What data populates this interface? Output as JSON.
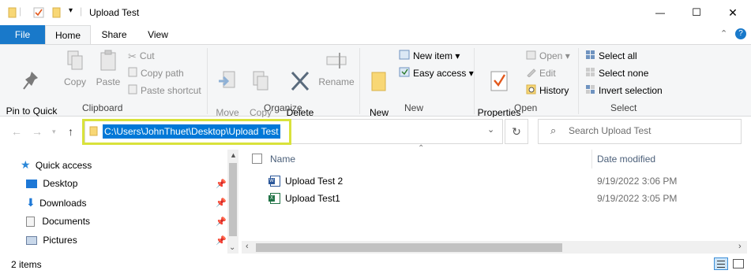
{
  "window": {
    "title": "Upload Test",
    "minimize_glyph": "—",
    "maximize_glyph": "☐",
    "close_glyph": "✕"
  },
  "ribbon_tabs": [
    "File",
    "Home",
    "Share",
    "View"
  ],
  "clipboard": {
    "pin_to_quick_access": "Pin to Quick\naccess",
    "copy": "Copy",
    "paste": "Paste",
    "cut": "Cut",
    "copy_path": "Copy path",
    "paste_shortcut": "Paste shortcut",
    "group_label": "Clipboard"
  },
  "organize": {
    "move_to": "Move\nto ▾",
    "copy_to": "Copy\nto ▾",
    "delete": "Delete\n▾",
    "rename": "Rename",
    "group_label": "Organize"
  },
  "new": {
    "new_folder": "New\nfolder",
    "new_item": "New item ▾",
    "easy_access": "Easy access ▾",
    "group_label": "New"
  },
  "open": {
    "properties": "Properties\n▾",
    "open": "Open ▾",
    "edit": "Edit",
    "history": "History",
    "group_label": "Open"
  },
  "select": {
    "select_all": "Select all",
    "select_none": "Select none",
    "invert_selection": "Invert selection",
    "group_label": "Select"
  },
  "address": {
    "path": "C:\\Users\\JohnThuet\\Desktop\\Upload Test"
  },
  "search": {
    "placeholder": "Search Upload Test"
  },
  "nav_pane": [
    {
      "label": "Quick access",
      "icon": "star-icon",
      "pinned": false
    },
    {
      "label": "Desktop",
      "icon": "desktop-icon",
      "pinned": true
    },
    {
      "label": "Downloads",
      "icon": "download-icon",
      "pinned": true
    },
    {
      "label": "Documents",
      "icon": "documents-icon",
      "pinned": true
    },
    {
      "label": "Pictures",
      "icon": "pictures-icon",
      "pinned": true
    }
  ],
  "file_list": {
    "columns": [
      "Name",
      "Date modified"
    ],
    "rows": [
      {
        "name": "Upload Test 2",
        "date": "9/19/2022 3:06 PM",
        "icon": "word-doc-icon",
        "color": "#2b579a"
      },
      {
        "name": "Upload Test1",
        "date": "9/19/2022 3:05 PM",
        "icon": "excel-doc-icon",
        "color": "#217346"
      }
    ]
  },
  "status_bar": {
    "item_count": "2 items"
  },
  "colors": {
    "accent": "#0078d7",
    "file_tab": "#1979ca",
    "highlight": "#d9e23b"
  }
}
